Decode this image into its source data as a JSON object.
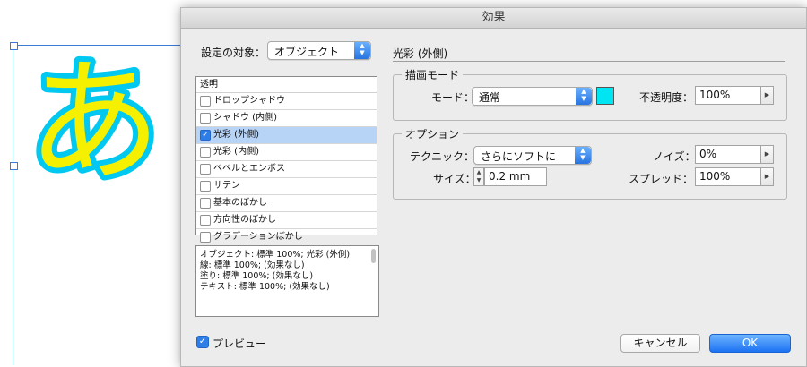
{
  "canvas": {
    "glyph": "あ",
    "glyph_fill": "#f5f000",
    "glow_color": "#00c8f0"
  },
  "dialog": {
    "title": "効果",
    "target_label": "設定の対象：",
    "target_value": "オブジェクト",
    "transparency_header": "透明",
    "effects": [
      {
        "label": "ドロップシャドウ",
        "checked": false,
        "selected": false
      },
      {
        "label": "シャドウ (内側)",
        "checked": false,
        "selected": false
      },
      {
        "label": "光彩 (外側)",
        "checked": true,
        "selected": true
      },
      {
        "label": "光彩 (内側)",
        "checked": false,
        "selected": false
      },
      {
        "label": "ベベルとエンボス",
        "checked": false,
        "selected": false
      },
      {
        "label": "サテン",
        "checked": false,
        "selected": false
      },
      {
        "label": "基本のぼかし",
        "checked": false,
        "selected": false
      },
      {
        "label": "方向性のぼかし",
        "checked": false,
        "selected": false
      },
      {
        "label": "グラデーションぼかし",
        "checked": false,
        "selected": false
      }
    ],
    "summary": [
      "オブジェクト: 標準 100%; 光彩 (外側)",
      "線: 標準 100%; (効果なし)",
      "塗り: 標準 100%; (効果なし)",
      "テキスト: 標準 100%; (効果なし)"
    ],
    "section_title": "光彩 (外側)",
    "blend": {
      "group_label": "描画モード",
      "mode_label": "モード：",
      "mode_value": "通常",
      "color": "#00e5f2",
      "opacity_label": "不透明度：",
      "opacity_value": "100%"
    },
    "options": {
      "group_label": "オプション",
      "technique_label": "テクニック：",
      "technique_value": "さらにソフトに",
      "size_label": "サイズ：",
      "size_value": "0.2 mm",
      "noise_label": "ノイズ：",
      "noise_value": "0%",
      "spread_label": "スプレッド：",
      "spread_value": "100%"
    },
    "preview_label": "プレビュー",
    "cancel_label": "キャンセル",
    "ok_label": "OK"
  }
}
